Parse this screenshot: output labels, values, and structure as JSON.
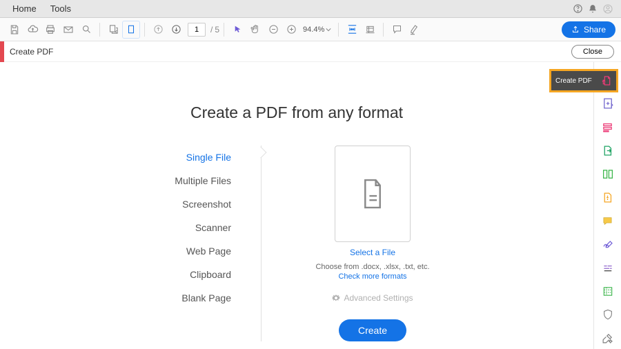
{
  "menubar": {
    "home": "Home",
    "tools": "Tools"
  },
  "toolbar": {
    "page_current": "1",
    "page_sep": "/",
    "page_total": "5",
    "zoom": "94.4%",
    "share_label": "Share"
  },
  "contextbar": {
    "title": "Create PDF",
    "close": "Close"
  },
  "callout": {
    "label": "Create PDF"
  },
  "heading": "Create a PDF from any format",
  "options": {
    "single": "Single File",
    "multiple": "Multiple Files",
    "screenshot": "Screenshot",
    "scanner": "Scanner",
    "webpage": "Web Page",
    "clipboard": "Clipboard",
    "blank": "Blank Page"
  },
  "right": {
    "select": "Select a File",
    "choose": "Choose from .docx, .xlsx, .txt, etc.",
    "check_more": "Check more formats",
    "advanced": "Advanced Settings",
    "create": "Create"
  }
}
